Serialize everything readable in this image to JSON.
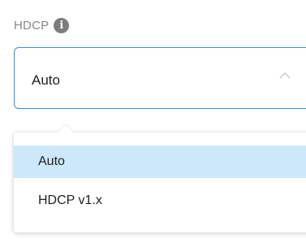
{
  "field": {
    "label": "HDCP",
    "info_icon": "info-icon",
    "info_glyph": "i"
  },
  "select": {
    "value": "Auto",
    "state": "open",
    "chevron_icon": "chevron-up-icon",
    "accent_color": "#3d8fd6"
  },
  "dropdown": {
    "options": [
      {
        "label": "Auto",
        "selected": true
      },
      {
        "label": "HDCP v1.x",
        "selected": false
      }
    ],
    "selected_bg_color": "#cde8f8"
  }
}
